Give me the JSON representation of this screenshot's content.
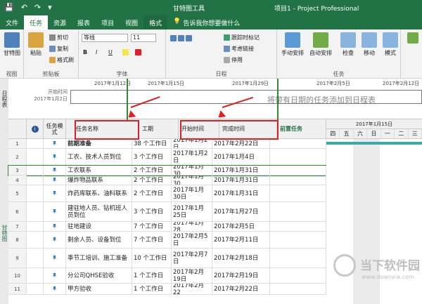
{
  "titlebar": {
    "tool_title": "甘特图工具",
    "app_title": "项目1 - Project Professional",
    "quick_access": [
      "💾",
      "↶",
      "↷",
      "▾"
    ]
  },
  "tabs": [
    "文件",
    "任务",
    "资源",
    "报表",
    "项目",
    "视图",
    "格式"
  ],
  "tell_me": "告诉我你想要做什么",
  "ribbon": {
    "view_group": {
      "label": "视图",
      "gantt_button": "甘特图"
    },
    "clipboard_group": {
      "label": "剪贴板",
      "paste": "粘贴",
      "cut": "剪切",
      "copy": "复制",
      "format_painter": "格式刷"
    },
    "font_group": {
      "label": "字体",
      "font_name": "等线",
      "font_size": "11",
      "bold": "B",
      "italic": "I",
      "underline": "U"
    },
    "schedule_group": {
      "label": "日程",
      "mark_on_track": "跟踪时标记",
      "respect_links": "考虑链接",
      "inactivate": "停用"
    },
    "tasks_group": {
      "label": "任务",
      "manual": "手动安排",
      "auto": "自动安排",
      "inspect": "检查",
      "move": "移动",
      "mode": "模式"
    }
  },
  "timeline": {
    "side_label": "日程表",
    "start_label": "开始时间",
    "start_date": "2017年1月2日",
    "ticks": [
      "2017年1月12日",
      "2017年1月15日",
      "2017年1月29日",
      "2017年2月5日",
      "2017年2月12日"
    ],
    "hint": "将带有日期的任务添加到日程表"
  },
  "grid": {
    "side_label": "甘特图",
    "headers": {
      "mode": "任务模式",
      "name": "任务名称",
      "duration": "工期",
      "start": "开始时间",
      "finish": "完成时间",
      "predecessors": "前置任务"
    },
    "rows": [
      {
        "num": "1",
        "name": "前期准备",
        "duration": "38 个工作日",
        "start": "2017年1月2日",
        "finish": "2017年2月22日"
      },
      {
        "num": "2",
        "name": "工农、技术人员到位",
        "duration": "3 个工作日",
        "start": "2017年1月2日",
        "finish": "2017年1月4日"
      },
      {
        "num": "3",
        "name": "工农联系",
        "duration": "2 个工作日",
        "start": "2017年1月30",
        "finish": "2017年1月31日"
      },
      {
        "num": "4",
        "name": "爆炸物品联系",
        "duration": "2 个工作日",
        "start": "2017年1月30",
        "finish": "2017年1月31日"
      },
      {
        "num": "5",
        "name": "炸药库联系、油料联系",
        "duration": "2 个工作日",
        "start": "2017年1月30日",
        "finish": "2017年1月31日"
      },
      {
        "num": "6",
        "name": "建驻地人员、钻机班人员到位",
        "duration": "3 个工作日",
        "start": "2017年1月25日",
        "finish": "2017年1月27日"
      },
      {
        "num": "7",
        "name": "驻地建设",
        "duration": "7 个工作日",
        "start": "2017年1月28",
        "finish": "2017年2月5日"
      },
      {
        "num": "8",
        "name": "剩余人员、设备到位",
        "duration": "7 个工作日",
        "start": "2017年2月5日",
        "finish": "2017年2月11日"
      },
      {
        "num": "9",
        "name": "季节工培训、施工准备",
        "duration": "10 个工作日",
        "start": "2017年2月7日",
        "finish": "2017年2月18日"
      },
      {
        "num": "10",
        "name": "分公司QHSE验收",
        "duration": "1 个工作日",
        "start": "2017年2月19日",
        "finish": "2017年2月19日"
      },
      {
        "num": "11",
        "name": "甲方验收",
        "duration": "1 个工作日",
        "start": "2017年2月22",
        "finish": "2017年2月22日"
      }
    ]
  },
  "gantt": {
    "week_label": "2017年1月15日",
    "days": [
      "四",
      "五",
      "六",
      "日",
      "一",
      "二",
      "三"
    ]
  },
  "watermark": {
    "title": "当下软件园",
    "url": "www.downxia.com"
  },
  "colors": {
    "accent": "#217346",
    "annotation": "#e02020",
    "summary_bar": "#3aa9a9",
    "pin": "#2b7bc3"
  }
}
